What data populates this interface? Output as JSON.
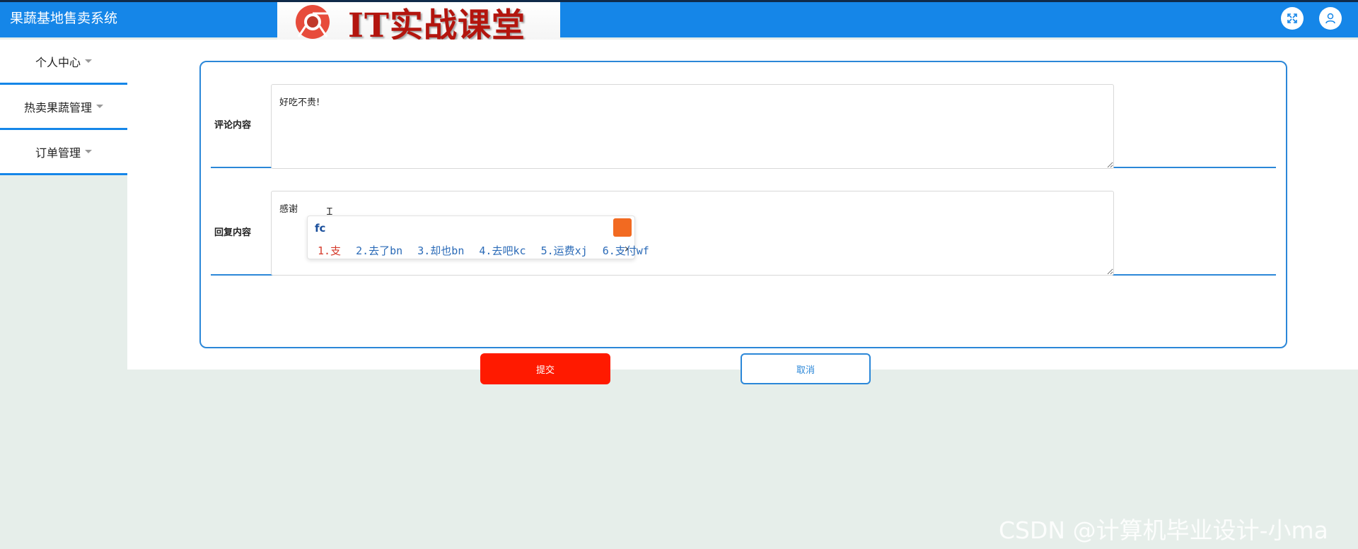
{
  "app": {
    "title": "果蔬基地售卖系统"
  },
  "banner": {
    "text": "IT实战课堂",
    "logo_icon": "chrome-logo-icon"
  },
  "header": {
    "fullscreen_icon": "expand-icon",
    "user_icon": "user-icon"
  },
  "sidebar": {
    "items": [
      {
        "label": "个人中心"
      },
      {
        "label": "热卖果蔬管理"
      },
      {
        "label": "订单管理"
      }
    ]
  },
  "form": {
    "comment": {
      "label": "评论内容",
      "value": "好吃不贵!"
    },
    "reply": {
      "label": "回复内容",
      "value": "感谢"
    },
    "submit_label": "提交",
    "cancel_label": "取消"
  },
  "ime": {
    "input": "fc",
    "candidates": [
      "1.支",
      "2.去了bn",
      "3.却也bn",
      "4.去吧kc",
      "5.运费xj",
      "6.支付wf"
    ],
    "more_icon": "chevron-right-icon"
  },
  "watermark": {
    "text": "CSDN @计算机毕业设计-小ma"
  },
  "colors": {
    "primary": "#1586e8",
    "submit": "#ff1a00",
    "background": "#e6eeea"
  }
}
